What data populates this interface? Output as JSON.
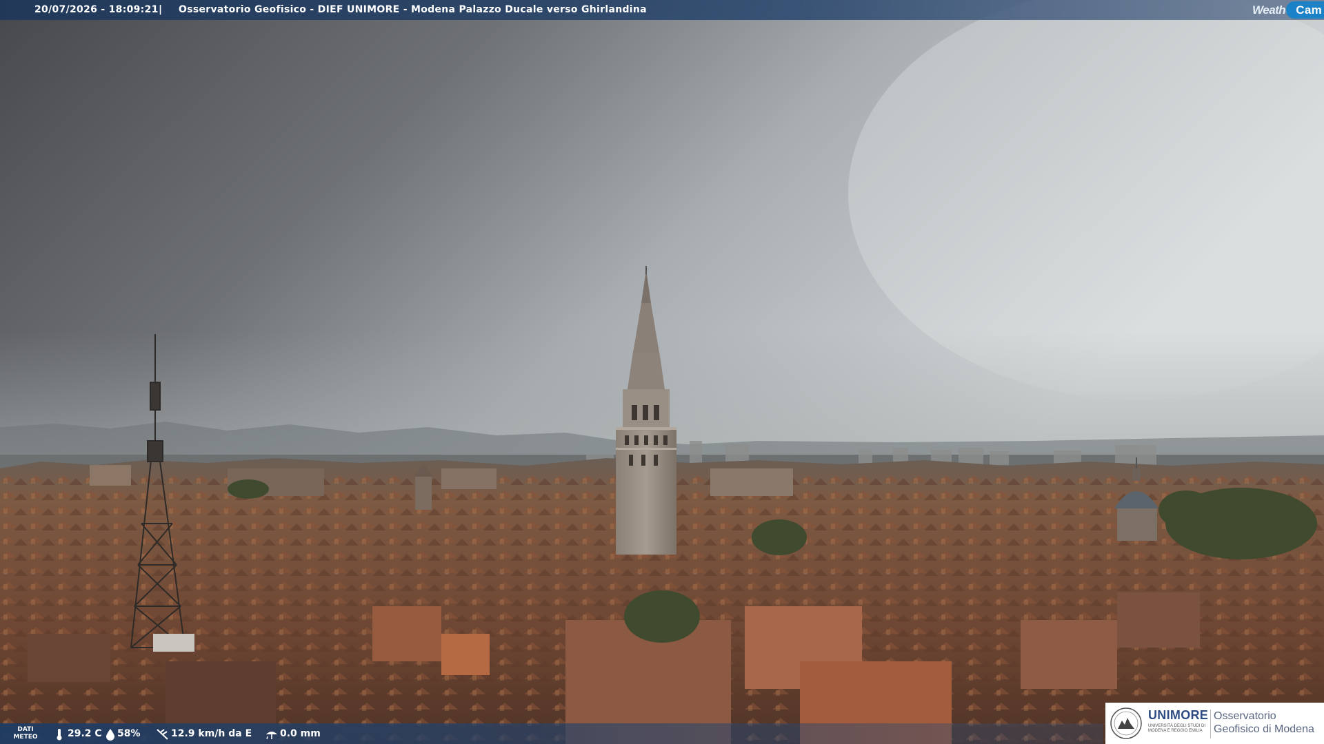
{
  "header": {
    "datetime": "20/07/2026 - 18:09:21",
    "separator": "|",
    "title": "Osservatorio Geofisico - DIEF UNIMORE - Modena Palazzo Ducale verso Ghirlandina",
    "brand_weather": "Weather",
    "brand_cam": "Cam"
  },
  "footer": {
    "meteo_label": "DATI METEO",
    "temperature": "29.2 C",
    "humidity": "58%",
    "wind": "12.9 km/h da E",
    "rain": "0.0 mm"
  },
  "logo": {
    "uni_name": "UNIMORE",
    "uni_subtitle": "UNIVERSITÀ DEGLI STUDI DI MODENA E REGGIO EMILIA",
    "observatory": "Osservatorio Geofisico di Modena"
  },
  "colors": {
    "sky_dark": "#4f5055",
    "sky_light": "#c9cfd2",
    "roofs": "#7a4a32",
    "brand_blue": "#1b82c8",
    "unimore_blue": "#2e4c83"
  },
  "icons": [
    "thermometer-icon",
    "humidity-drop-icon",
    "wind-icon",
    "rain-icon",
    "university-seal-icon"
  ]
}
